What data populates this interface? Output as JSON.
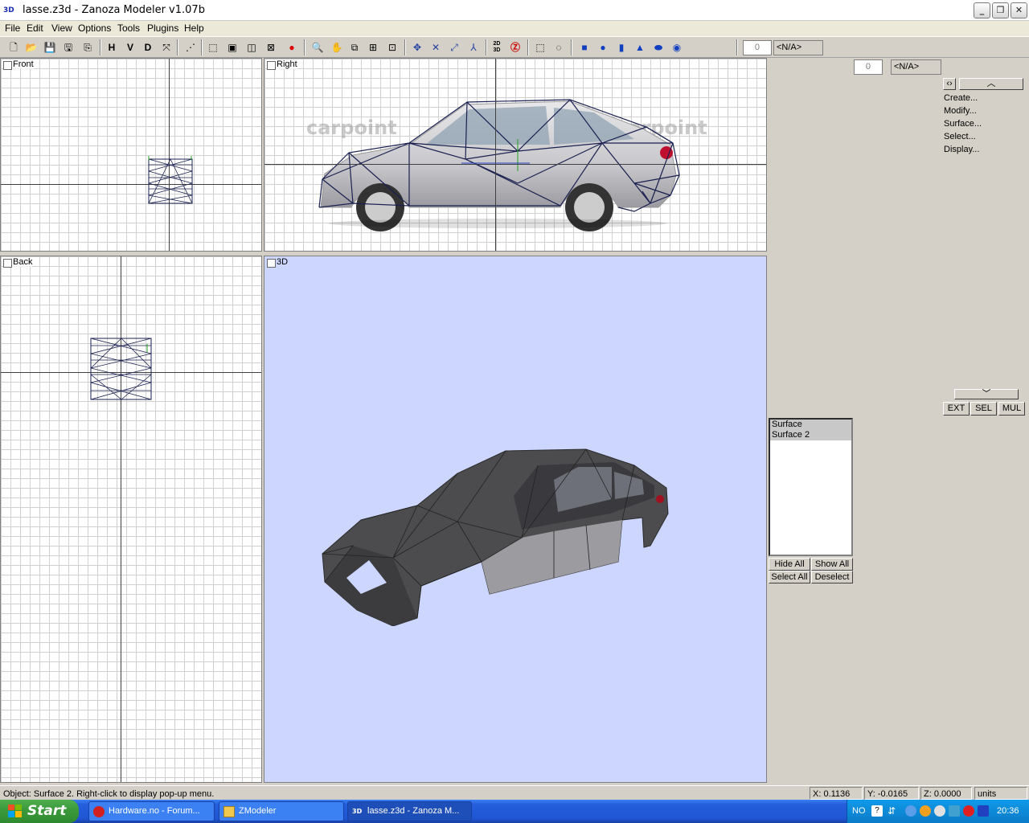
{
  "window": {
    "title": "lasse.z3d - Zanoza Modeler v1.07b",
    "icon_label": "3D",
    "buttons": [
      "minimize-icon",
      "restore-icon",
      "close-icon"
    ]
  },
  "menu": [
    "File",
    "Edit",
    "View",
    "Options",
    "Tools",
    "Plugins",
    "Help"
  ],
  "toolbar": {
    "axis_buttons": [
      "H",
      "V",
      "D"
    ],
    "spin_value": "0",
    "field_value": "<N/A>",
    "label_2d3d": "2D 3D"
  },
  "viewports": {
    "front": "Front",
    "right": "Right",
    "back": "Back",
    "threed": "3D"
  },
  "right_view_watermark": "carpoint",
  "panel": {
    "spin_value": "0",
    "field_value": "<N/A>",
    "commands": [
      "Create...",
      "Modify...",
      "Surface...",
      "Select...",
      "Display..."
    ],
    "mode_buttons": [
      "EXT",
      "SEL",
      "MUL"
    ],
    "surfaces": [
      "Surface",
      "Surface 2"
    ],
    "list_buttons": {
      "hide_all": "Hide All",
      "show_all": "Show All",
      "select_all": "Select All",
      "deselect": "Deselect"
    }
  },
  "status": {
    "message": "Object: Surface 2. Right-click to display pop-up menu.",
    "x": "X: 0.1136",
    "y": "Y: -0.0165",
    "z": "Z: 0.0000",
    "units": "units"
  },
  "taskbar": {
    "start": "Start",
    "tasks": [
      "Hardware.no - Forum...",
      "ZModeler",
      "lasse.z3d - Zanoza M..."
    ],
    "lang": "NO",
    "clock": "20:36"
  },
  "colors": {
    "viewport_3d_bg": "#ccd6ff",
    "taskbar_blue": "#245edb",
    "start_green": "#3c9a3c",
    "wire_color": "#1a2050"
  }
}
